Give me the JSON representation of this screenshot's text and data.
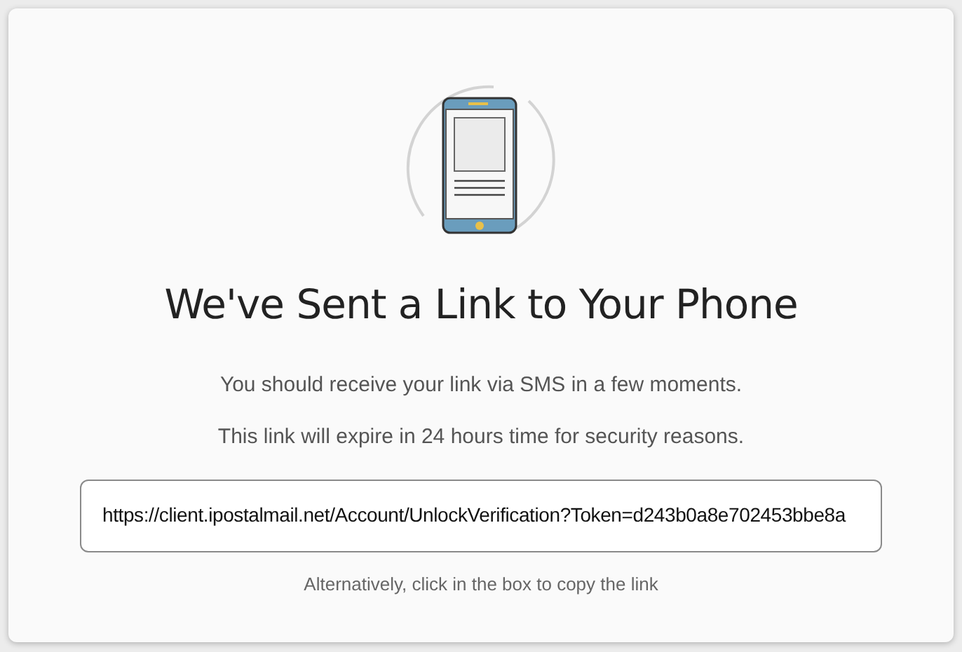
{
  "heading": "We've Sent a Link to Your Phone",
  "messages": [
    "You should receive your link via SMS in a few moments.",
    "This link will expire in 24 hours time for security reasons."
  ],
  "link_field": {
    "value": "https://client.ipostalmail.net/Account/UnlockVerification?Token=d243b0a8e702453bbe8a"
  },
  "hint": "Alternatively, click in the box to copy the link"
}
